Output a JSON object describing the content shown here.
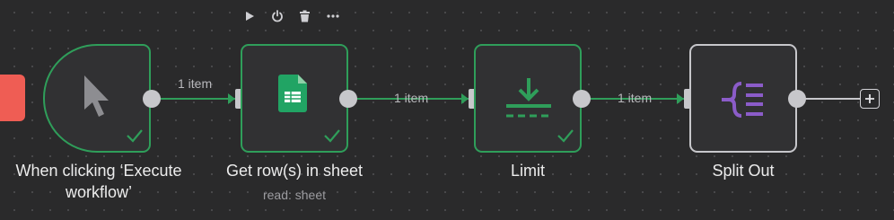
{
  "toolbar": {
    "icons": [
      "play-icon",
      "power-icon",
      "trash-icon",
      "more-icon"
    ]
  },
  "nodes": [
    {
      "label": "When clicking ‘Execute workflow’",
      "icon": "cursor-icon",
      "status": "success"
    },
    {
      "label": "Get row(s) in sheet",
      "subtitle": "read: sheet",
      "icon": "google-sheets-icon",
      "status": "success"
    },
    {
      "label": "Limit",
      "icon": "limit-icon",
      "status": "success"
    },
    {
      "label": "Split Out",
      "icon": "split-out-icon",
      "status": "none"
    }
  ],
  "edges": [
    {
      "label": "1 item"
    },
    {
      "label": "1 item"
    },
    {
      "label": "1 item"
    }
  ],
  "colors": {
    "canvas": "#2a2a2b",
    "node_bg": "#313133",
    "success": "#2f9e5a",
    "sheets": "#21a464",
    "split_out": "#8b5cc9",
    "trigger_stub": "#ef5d54"
  }
}
